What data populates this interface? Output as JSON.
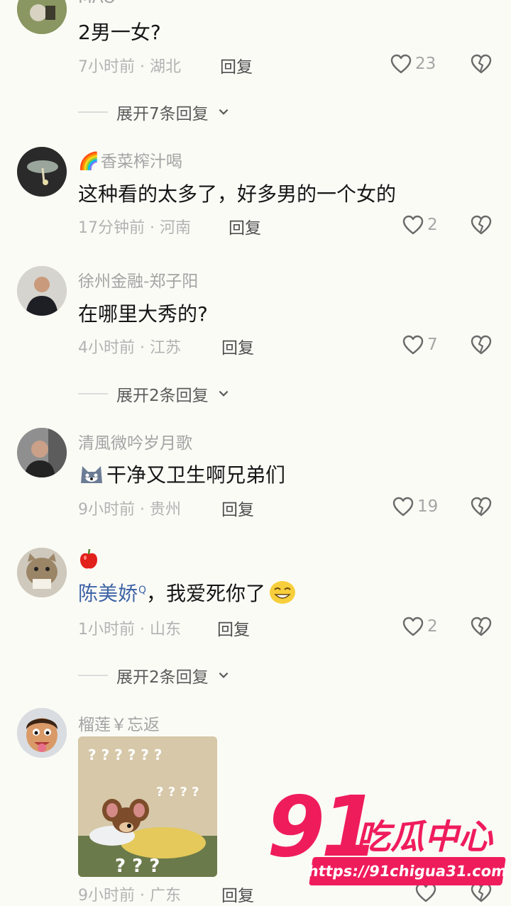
{
  "comments": [
    {
      "username": "MAO",
      "text": "2男一女?",
      "time": "7小时前 · 湖北",
      "reply": "回复",
      "likes": "23"
    },
    {
      "username": "香菜榨汁喝",
      "text": "这种看的太多了，好多男的一个女的",
      "time": "17分钟前 · 河南",
      "reply": "回复",
      "likes": "2"
    },
    {
      "username": "徐州金融-郑子阳",
      "text": "在哪里大秀的?",
      "time": "4小时前 · 江苏",
      "reply": "回复",
      "likes": "7"
    },
    {
      "username": "清風微吟岁月歌",
      "text": "干净又卫生啊兄弟们",
      "time": "9小时前 · 贵州",
      "reply": "回复",
      "likes": "19"
    },
    {
      "username": "",
      "mention": "陈美娇",
      "text": "，我爱死你了",
      "time": "1小时前 · 山东",
      "reply": "回复",
      "likes": "2"
    },
    {
      "username": "榴莲￥忘返",
      "time": "9小时前 · 广东",
      "reply": "回复"
    }
  ],
  "expand": [
    "展开7条回复",
    "展开2条回复",
    "展开2条回复"
  ],
  "sticker": {
    "marks": "? ? ? ? ? ?",
    "marks2": "? ? ? ?",
    "marks3": "? ? ?"
  },
  "watermark": {
    "number": "91",
    "label": "吃瓜中心",
    "url": "https://91chigua31.com"
  },
  "colors": {
    "background": "#fbfbf6",
    "mention": "#3f63a6",
    "watermark": "#ef1c5c"
  }
}
